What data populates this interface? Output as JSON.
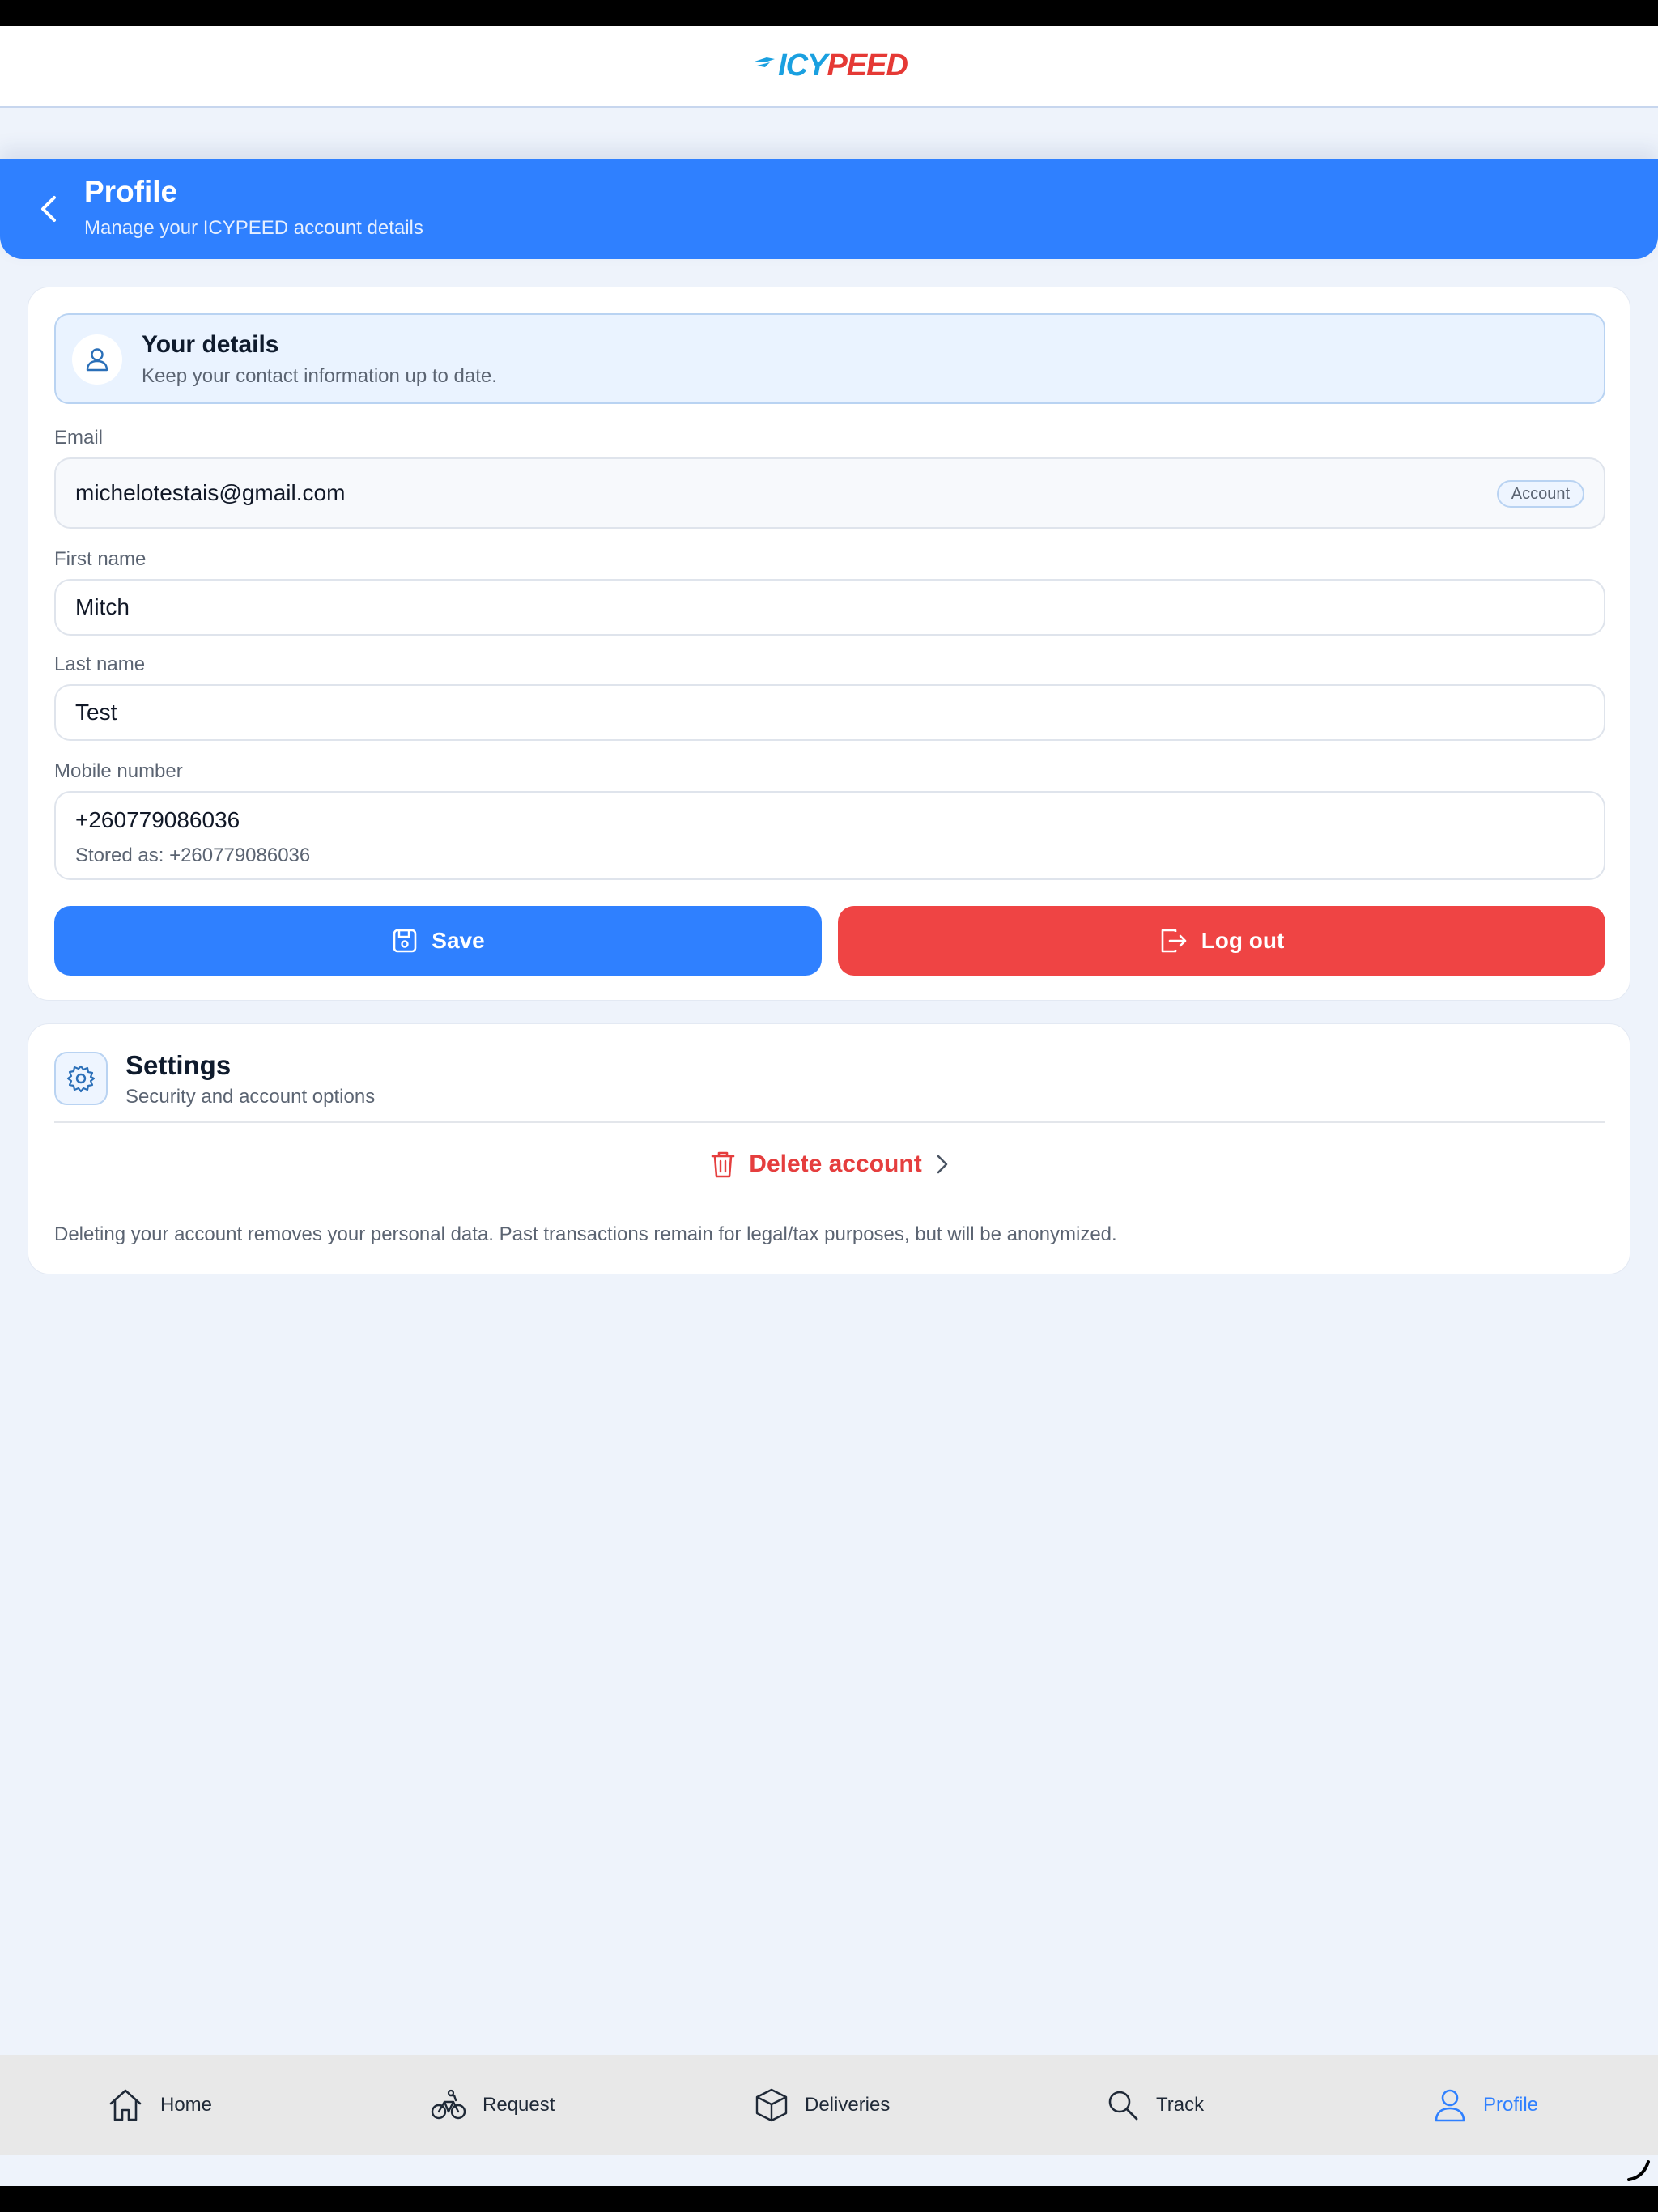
{
  "logo": {
    "part1": "ICY",
    "part2": "PEED"
  },
  "header": {
    "title": "Profile",
    "subtitle": "Manage your ICYPEED account details"
  },
  "details": {
    "title": "Your details",
    "subtitle": "Keep your contact information up to date.",
    "email": {
      "label": "Email",
      "value": "michelotestais@gmail.com",
      "badge": "Account"
    },
    "first_name": {
      "label": "First name",
      "value": "Mitch"
    },
    "last_name": {
      "label": "Last name",
      "value": "Test"
    },
    "mobile": {
      "label": "Mobile number",
      "value": "+260779086036",
      "stored": "Stored as: +260779086036"
    },
    "save_label": "Save",
    "logout_label": "Log out"
  },
  "settings": {
    "title": "Settings",
    "subtitle": "Security and account options",
    "delete_label": "Delete account",
    "note": "Deleting your account removes your personal data. Past transactions remain for legal/tax purposes, but will be anonymized."
  },
  "nav": {
    "items": [
      {
        "label": "Home",
        "icon": "home-icon"
      },
      {
        "label": "Request",
        "icon": "bicycle-icon"
      },
      {
        "label": "Deliveries",
        "icon": "box-icon"
      },
      {
        "label": "Track",
        "icon": "search-icon"
      },
      {
        "label": "Profile",
        "icon": "user-icon"
      }
    ],
    "active": "Profile"
  },
  "colors": {
    "primary": "#2f80ff",
    "danger": "#ef4444",
    "background": "#eef3fb"
  }
}
